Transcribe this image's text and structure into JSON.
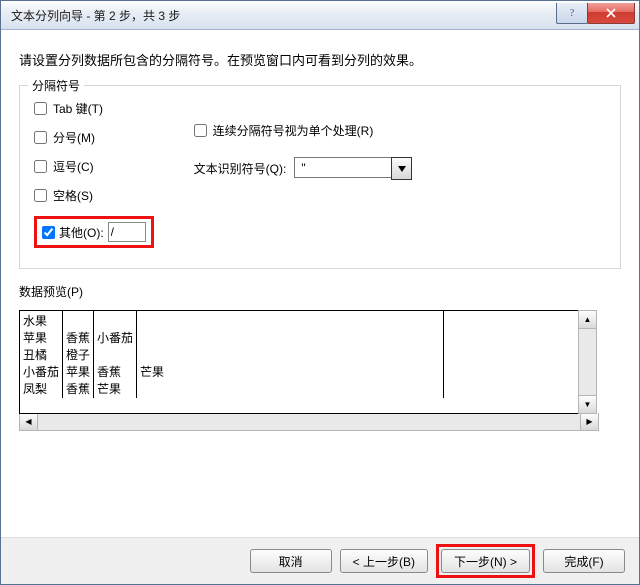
{
  "title": "文本分列向导 - 第 2 步，共 3 步",
  "instruction": "请设置分列数据所包含的分隔符号。在预览窗口内可看到分列的效果。",
  "group_delim": "分隔符号",
  "delim": {
    "tab": "Tab 键(T)",
    "semicolon": "分号(M)",
    "comma": "逗号(C)",
    "space": "空格(S)",
    "other": "其他(O):",
    "other_value": "/"
  },
  "consecutive": "连续分隔符号视为单个处理(R)",
  "qualifier_label": "文本识别符号(Q):",
  "qualifier_value": "\"",
  "preview_label": "数据预览(P)",
  "preview": {
    "rows": [
      [
        "水果",
        "",
        "",
        ""
      ],
      [
        "苹果",
        "香蕉",
        "小番茄",
        ""
      ],
      [
        "丑橘",
        "橙子",
        "",
        ""
      ],
      [
        "小番茄",
        "苹果",
        "香蕉",
        "芒果"
      ],
      [
        "凤梨",
        "香蕉",
        "芒果",
        ""
      ]
    ]
  },
  "buttons": {
    "cancel": "取消",
    "back": "< 上一步(B)",
    "next": "下一步(N) >",
    "finish": "完成(F)"
  }
}
